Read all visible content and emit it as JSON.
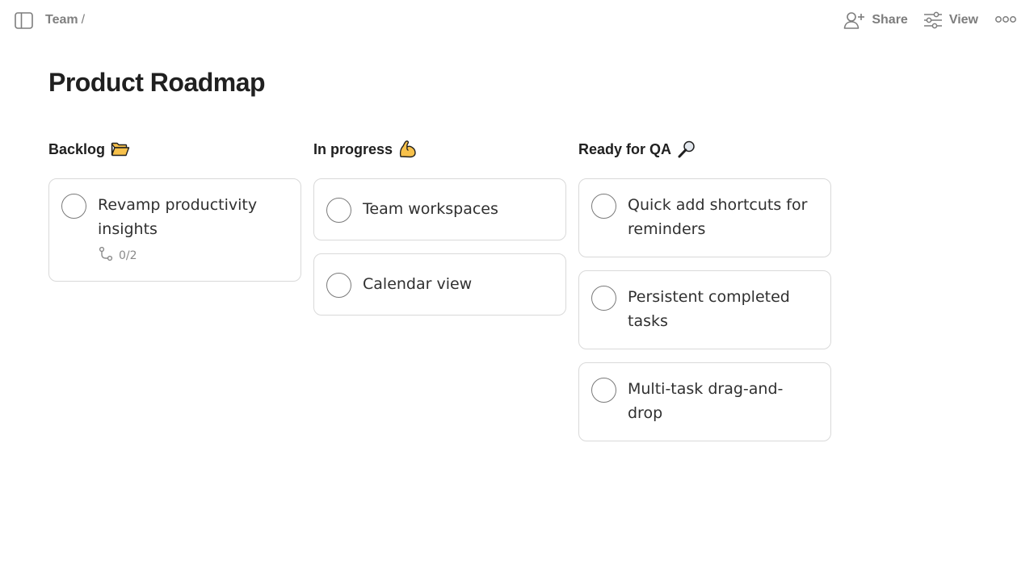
{
  "breadcrumb": {
    "team": "Team",
    "separator": "/"
  },
  "toolbar": {
    "share_label": "Share",
    "view_label": "View"
  },
  "page": {
    "title": "Product Roadmap"
  },
  "icons": {
    "sidebar_toggle": "sidebar-toggle-icon",
    "share": "add-person-icon",
    "view": "sliders-icon",
    "more": "more-horizontal-icon",
    "subtask": "subtask-branch-icon"
  },
  "colors": {
    "emoji_yellow": "#f7c14b",
    "text": "#202020",
    "muted": "#808080",
    "card_border": "#d9d9d9"
  },
  "board": {
    "columns": [
      {
        "title": "Backlog",
        "emoji": "folder",
        "cards": [
          {
            "title": "Revamp productivity insights",
            "subtasks": "0/2"
          }
        ]
      },
      {
        "title": "In progress",
        "emoji": "flexed-biceps",
        "cards": [
          {
            "title": "Team workspaces"
          },
          {
            "title": "Calendar view"
          }
        ]
      },
      {
        "title": "Ready for QA",
        "emoji": "magnifying-glass",
        "cards": [
          {
            "title": "Quick add shortcuts for reminders"
          },
          {
            "title": "Persistent completed tasks"
          },
          {
            "title": "Multi-task drag-and-drop"
          }
        ]
      }
    ]
  }
}
